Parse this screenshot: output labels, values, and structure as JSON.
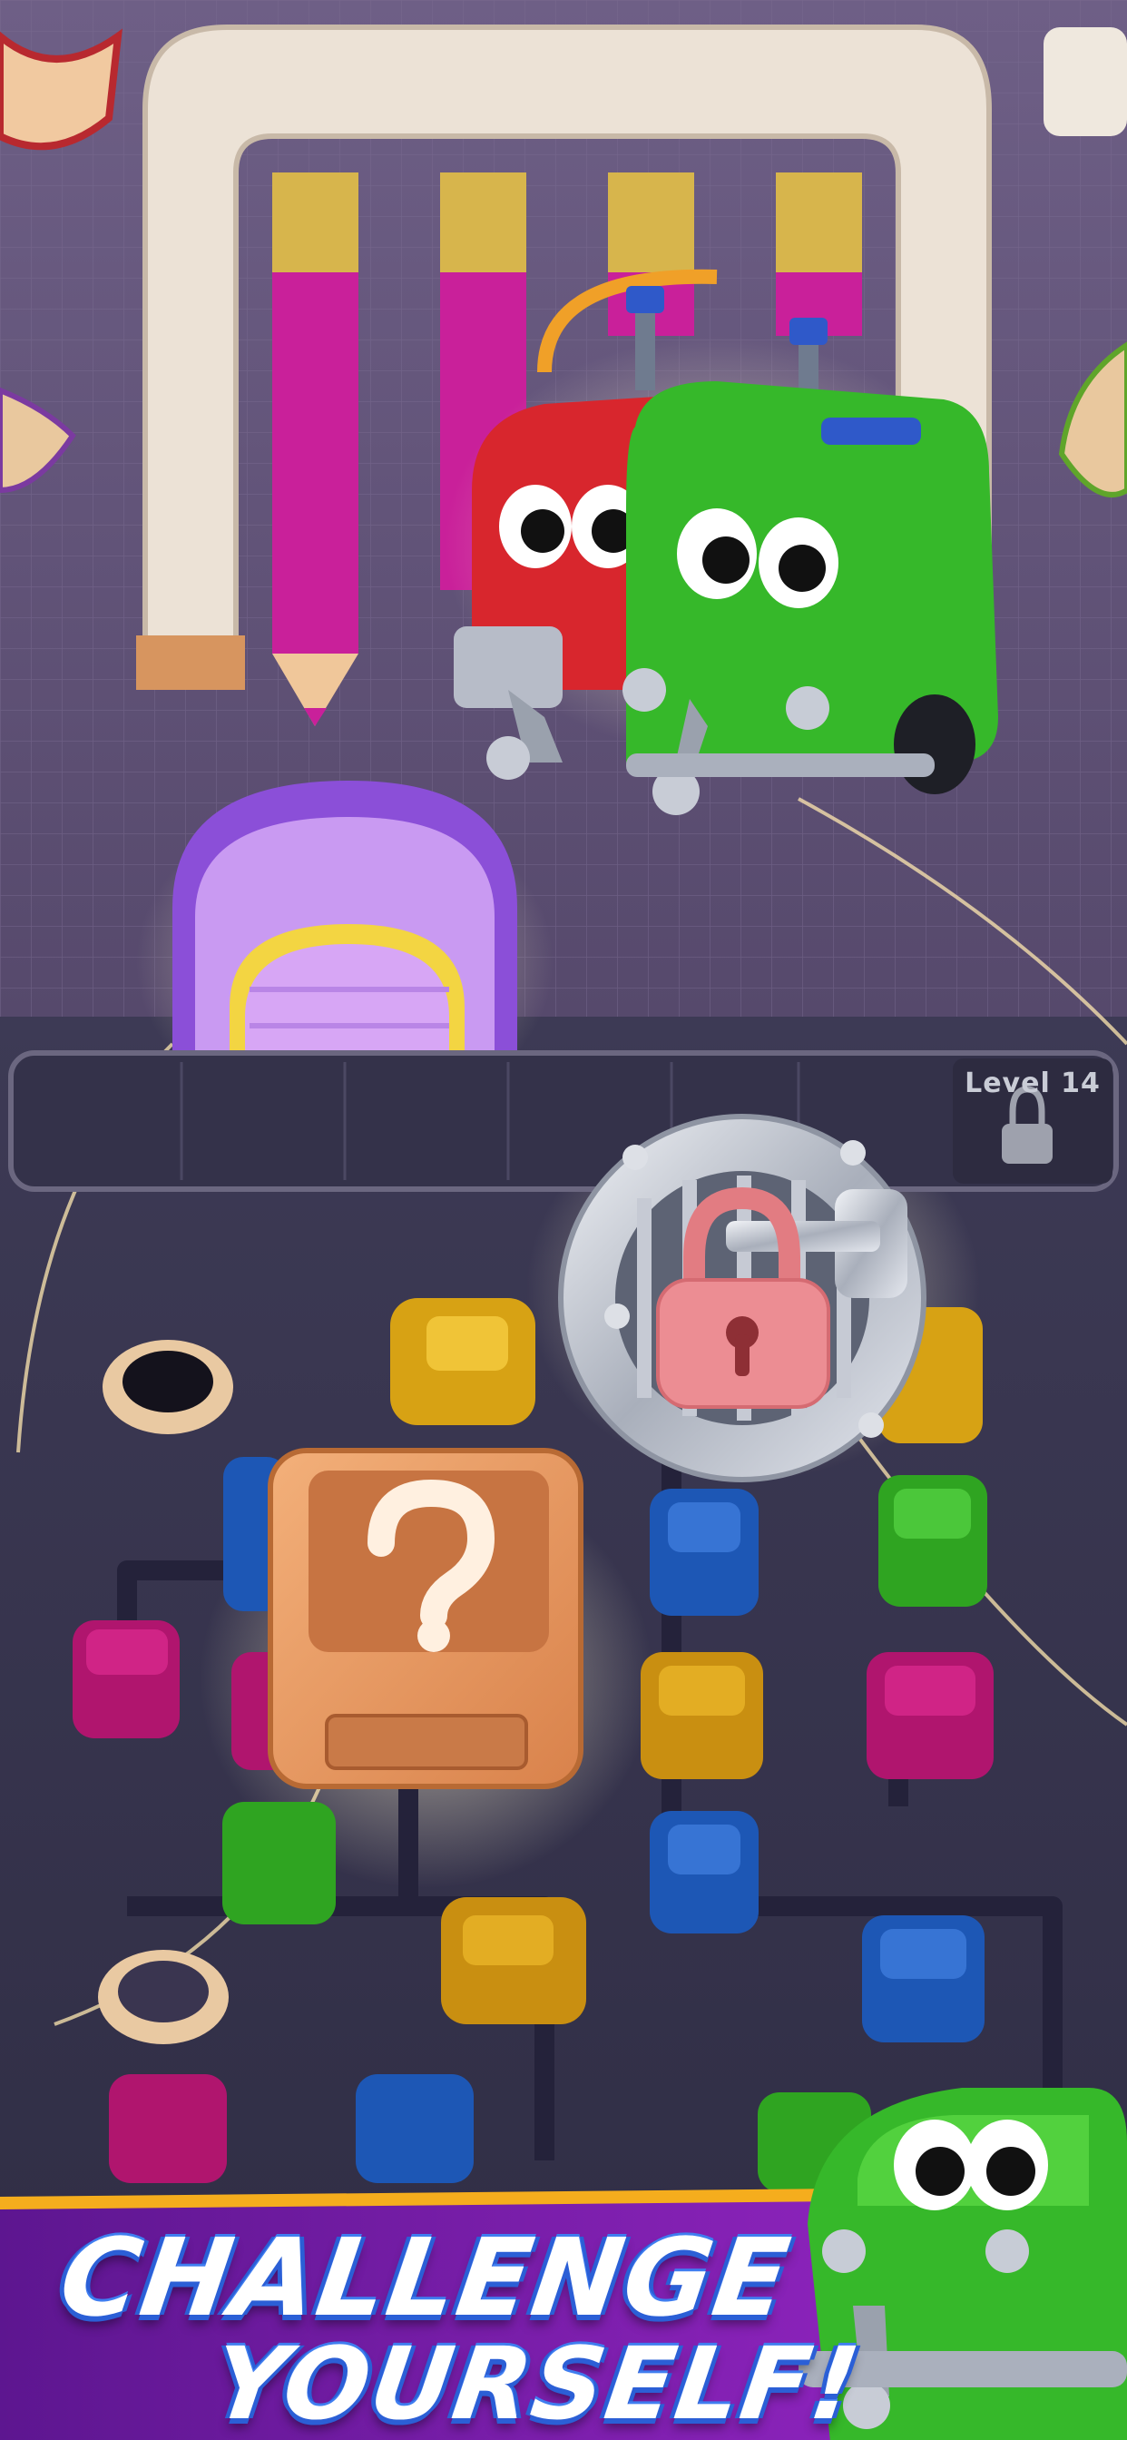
{
  "level_indicator": {
    "label": "Level 14"
  },
  "banner": {
    "line1": "CHALLENGE",
    "line2": "YOURSELF!"
  },
  "icons": [
    "lock-icon",
    "question-mark-icon",
    "vault-lock-icon",
    "car-tunnel-icon"
  ],
  "colors": {
    "red": "#d8262d",
    "green": "#36b82a",
    "purple": "#8b4fd8",
    "blue": "#1d57b5",
    "yellow": "#e0a615",
    "magenta": "#c8157a",
    "banner": "#7a1ba8"
  }
}
